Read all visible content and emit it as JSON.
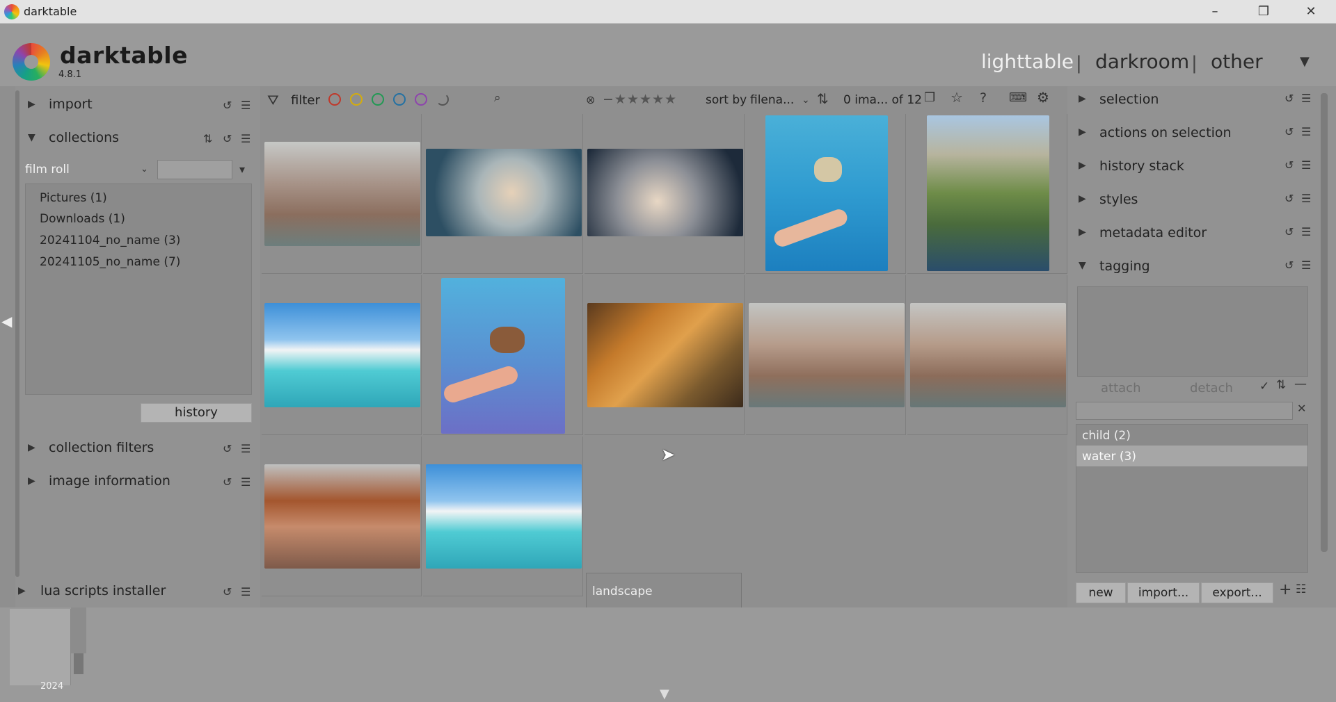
{
  "window": {
    "app_title": "darktable",
    "minimize": "–",
    "restore": "❐",
    "close": "✕"
  },
  "header": {
    "app_name": "darktable",
    "version": "4.8.1",
    "views": [
      "lighttable",
      "darkroom",
      "other"
    ],
    "separator": "|"
  },
  "left": {
    "import": "import",
    "collections": "collections",
    "film_roll": "film roll",
    "film_rolls": [
      "Pictures (1)",
      "Downloads (1)",
      "20241104_no_name (3)",
      "20241105_no_name (7)"
    ],
    "history_btn": "history",
    "collection_filters": "collection filters",
    "image_information": "image information",
    "lua_scripts": "lua scripts installer"
  },
  "toolbar": {
    "filter": "filter",
    "sort_by": "sort by",
    "sort_field": "filena...",
    "count": "0 ima... of 12"
  },
  "grid_tooltip": "landscape",
  "right": {
    "modules": [
      "selection",
      "actions on selection",
      "history stack",
      "styles",
      "metadata editor",
      "tagging"
    ],
    "attach": "attach",
    "detach": "detach",
    "tags": [
      "child (2)",
      "water (3)"
    ],
    "new": "new",
    "import": "import...",
    "export": "export..."
  },
  "timeline": {
    "year": "2024"
  },
  "colors": {
    "accent_label_red": "#e74c3c",
    "accent_label_yellow": "#f1c40f",
    "accent_label_green": "#2ecc71",
    "accent_label_blue": "#3498db",
    "accent_label_purple": "#9b59b6"
  }
}
